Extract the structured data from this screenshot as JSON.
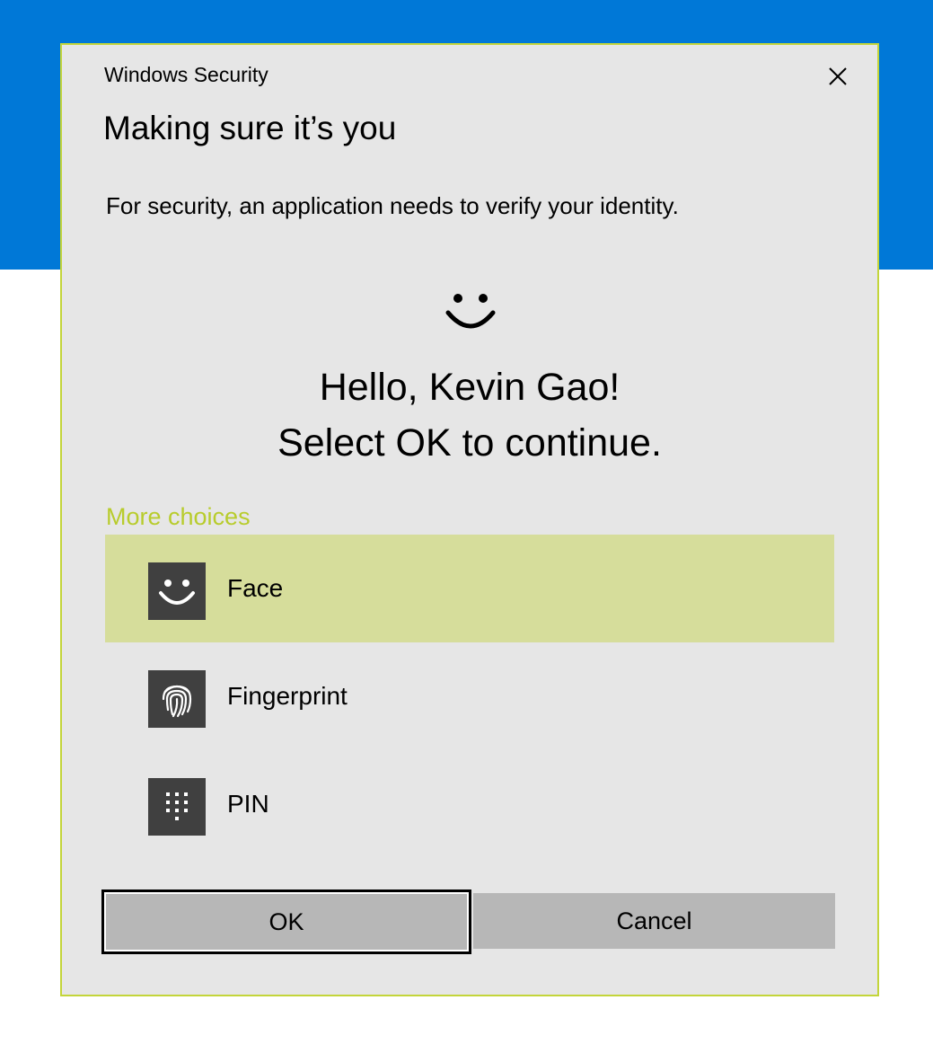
{
  "window": {
    "title": "Windows Security"
  },
  "dialog": {
    "heading": "Making sure it’s you",
    "description": "For security, an application needs to verify your identity.",
    "greeting_line1": "Hello, Kevin Gao!",
    "greeting_line2": "Select OK to continue.",
    "more_choices_label": "More choices"
  },
  "choices": [
    {
      "label": "Face",
      "icon": "face-icon",
      "selected": true
    },
    {
      "label": "Fingerprint",
      "icon": "fingerprint-icon",
      "selected": false
    },
    {
      "label": "PIN",
      "icon": "pin-keypad-icon",
      "selected": false
    }
  ],
  "buttons": {
    "ok_label": "OK",
    "cancel_label": "Cancel"
  },
  "colors": {
    "background_accent": "#0078d7",
    "dialog_border": "#c3d53a",
    "more_choices_text": "#b8cc2c",
    "selected_choice_bg": "#d6dd9b",
    "button_bg": "#b7b7b7"
  }
}
